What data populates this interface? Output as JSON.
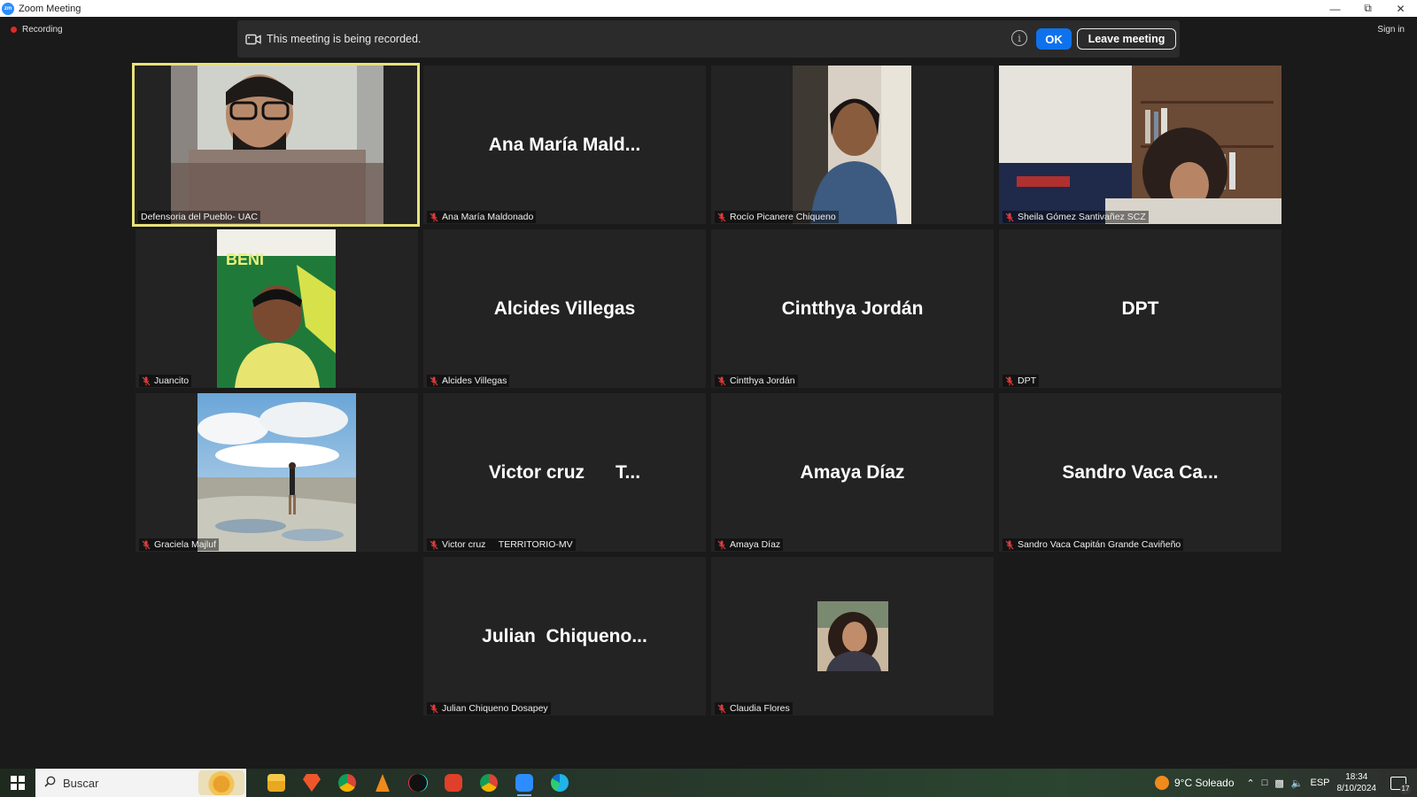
{
  "window": {
    "app_icon_text": "zm",
    "title": "Zoom Meeting",
    "controls": [
      "minimize",
      "restore",
      "close"
    ]
  },
  "meeting": {
    "recording_label": "Recording",
    "sign_in_label": "Sign in",
    "banner": {
      "message": "This meeting is being recorded.",
      "info_symbol": "i",
      "ok_label": "OK",
      "leave_label": "Leave meeting"
    },
    "tiles": [
      {
        "name": "Defensoria del Pueblo- UAC",
        "big": "",
        "active": true,
        "muted": false
      },
      {
        "name": "Ana María Maldonado",
        "big": "Ana María Mald...",
        "active": false,
        "muted": true
      },
      {
        "name": "Rocío Picanere Chiqueno",
        "big": "",
        "active": false,
        "muted": true
      },
      {
        "name": "Sheila Gómez Santivañez SCZ",
        "big": "",
        "active": false,
        "muted": true
      },
      {
        "name": "Juancito",
        "big": "",
        "active": false,
        "muted": true
      },
      {
        "name": "Alcides Villegas",
        "big": "Alcides Villegas",
        "active": false,
        "muted": true
      },
      {
        "name": "Cintthya Jordán",
        "big": "Cintthya Jordán",
        "active": false,
        "muted": true
      },
      {
        "name": "DPT",
        "big": "DPT",
        "active": false,
        "muted": true
      },
      {
        "name": "Graciela Majluf",
        "big": "",
        "active": false,
        "muted": true
      },
      {
        "name": "Victor cruz     TERRITORIO-MV",
        "big": "Victor cruz      T...",
        "active": false,
        "muted": true
      },
      {
        "name": "Amaya Díaz",
        "big": "Amaya Díaz",
        "active": false,
        "muted": true
      },
      {
        "name": "Sandro Vaca Capitán Grande Caviñeño",
        "big": "Sandro Vaca Ca...",
        "active": false,
        "muted": true
      },
      {
        "name": "Julian Chiqueno Dosapey",
        "big": "Julian  Chiqueno...",
        "active": false,
        "muted": true
      },
      {
        "name": "Claudia Flores",
        "big": "",
        "active": false,
        "muted": true
      }
    ]
  },
  "taskbar": {
    "search_placeholder": "Buscar",
    "apps": [
      "file-explorer-icon",
      "brave-icon",
      "chrome-icon",
      "vlc-icon",
      "tiktok-icon",
      "brave-red-icon",
      "chrome-profile-icon",
      "zoom-icon",
      "edge-icon"
    ],
    "active_app": "zoom-icon",
    "weather": "9°C  Soleado",
    "language": "ESP",
    "time": "18:34",
    "date": "8/10/2024",
    "notification_count": "17"
  }
}
